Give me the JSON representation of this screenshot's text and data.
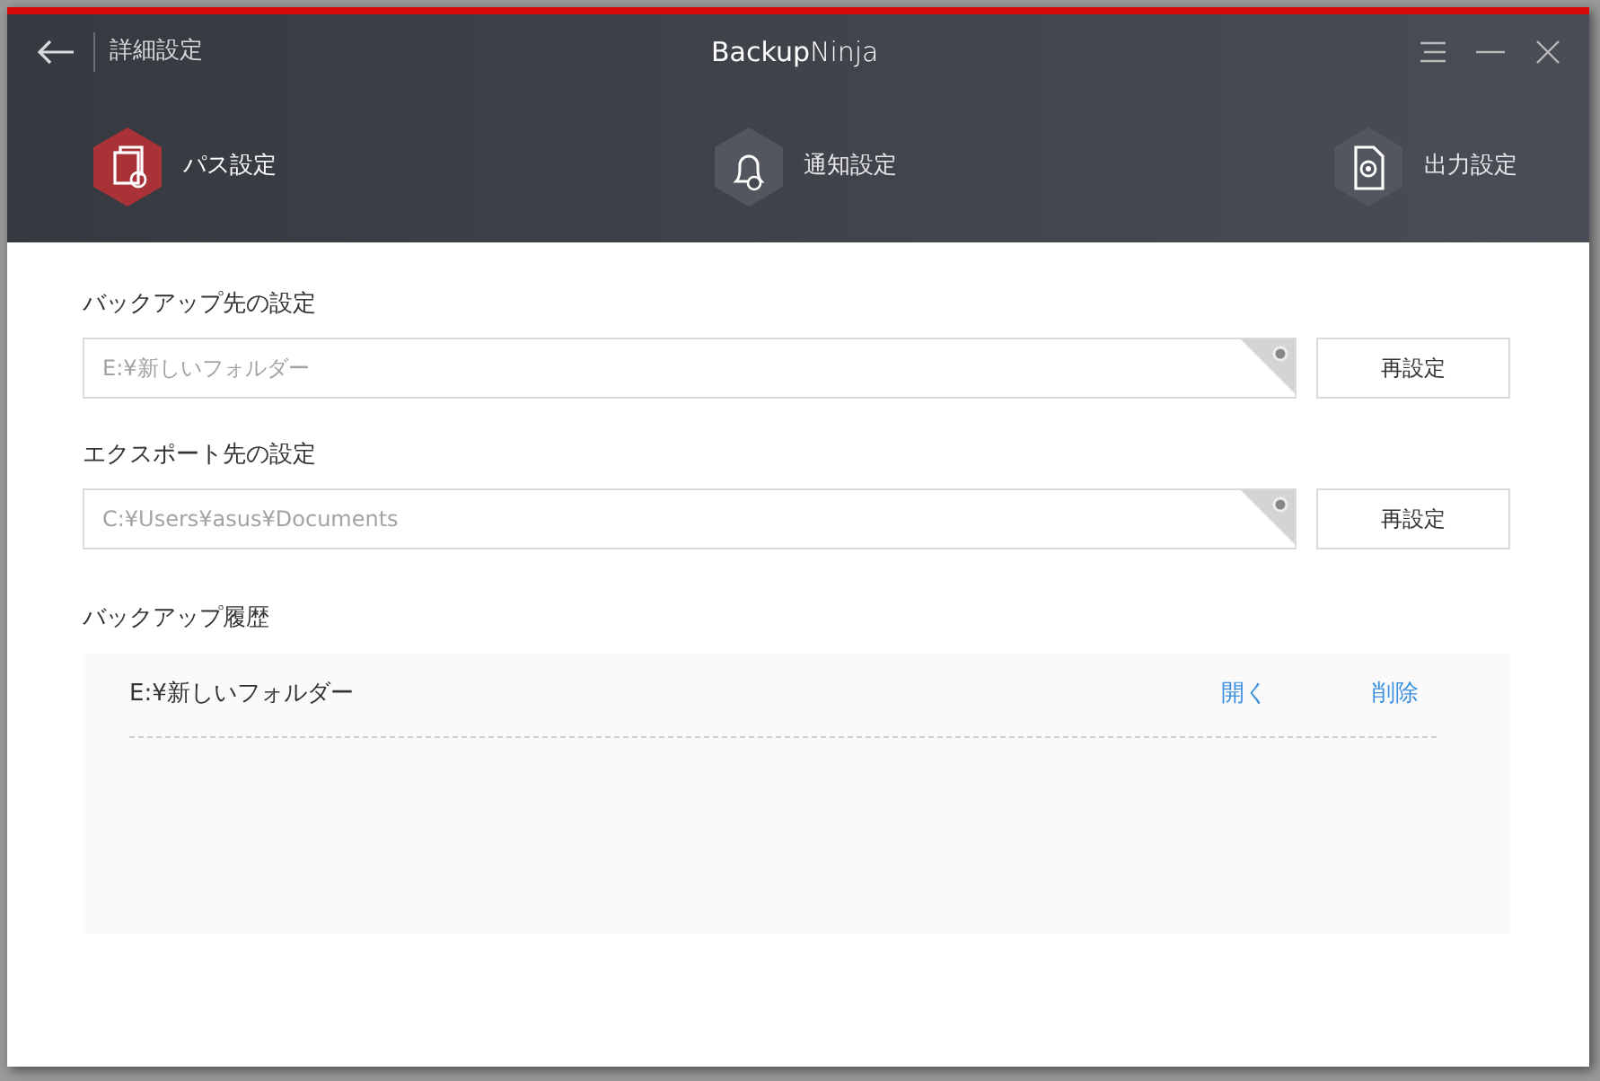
{
  "header": {
    "back_label": "詳細設定",
    "title": "**Backup**Ninja"
  },
  "tabs": [
    {
      "label": "パス設定",
      "kind": "path",
      "selected": true
    },
    {
      "label": "通知設定",
      "kind": "notify",
      "selected": false
    },
    {
      "label": "出力設定",
      "kind": "output",
      "selected": false
    }
  ],
  "sections": [
    {
      "heading": "バックアップ先の設定",
      "value": "E:¥新しいフォルダー",
      "button": "再設定"
    },
    {
      "heading": "エクスポート先の設定",
      "value": "C:¥Users¥asus¥Documents",
      "button": "再設定"
    }
  ],
  "history": {
    "heading": "バックアップ履歴",
    "rows": [
      {
        "path": "E:¥新しいフォルダー",
        "open": "開く",
        "delete": "削除"
      }
    ]
  }
}
